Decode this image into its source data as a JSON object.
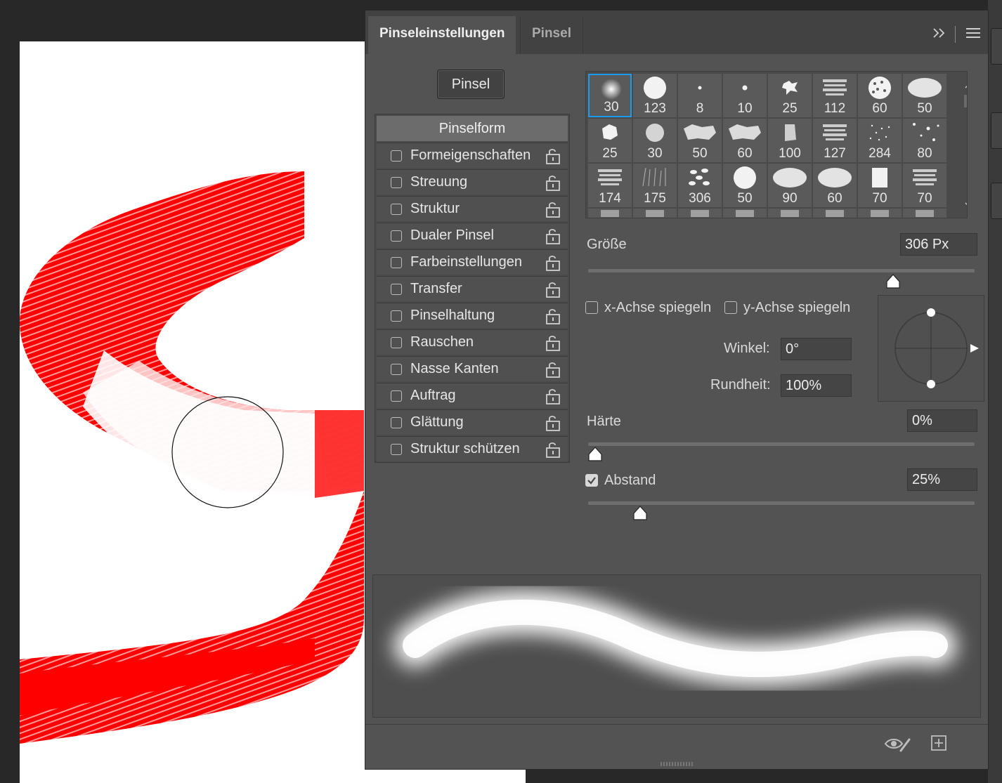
{
  "tabs": {
    "settings": "Pinseleinstellungen",
    "brush": "Pinsel"
  },
  "icons": {
    "collapse": "double-chevron-right-icon",
    "menu": "hamburger-menu-icon",
    "lock": "unlock-icon",
    "eye_brush": "toggle-preview-icon",
    "new_preset": "new-brush-preset-icon"
  },
  "brush_button": "Pinsel",
  "options": {
    "header": "Pinselform",
    "items": [
      {
        "label": "Formeigenschaften",
        "checked": false
      },
      {
        "label": "Streuung",
        "checked": false
      },
      {
        "label": "Struktur",
        "checked": false
      },
      {
        "label": "Dualer Pinsel",
        "checked": false
      },
      {
        "label": "Farbeinstellungen",
        "checked": false
      },
      {
        "label": "Transfer",
        "checked": false
      },
      {
        "label": "Pinselhaltung",
        "checked": false
      },
      {
        "label": "Rauschen",
        "checked": false
      },
      {
        "label": "Nasse Kanten",
        "checked": false
      },
      {
        "label": "Auftrag",
        "checked": false
      },
      {
        "label": "Glättung",
        "checked": false
      },
      {
        "label": "Struktur schützen",
        "checked": false
      }
    ]
  },
  "brush_tips": [
    {
      "size": "30",
      "kind": "soft-round",
      "selected": true
    },
    {
      "size": "123",
      "kind": "hard-round"
    },
    {
      "size": "8",
      "kind": "dot-small"
    },
    {
      "size": "10",
      "kind": "dot"
    },
    {
      "size": "25",
      "kind": "splat"
    },
    {
      "size": "112",
      "kind": "texture"
    },
    {
      "size": "60",
      "kind": "sponge"
    },
    {
      "size": "50",
      "kind": "oval-texture"
    },
    {
      "size": "25",
      "kind": "blob"
    },
    {
      "size": "30",
      "kind": "fuzzy"
    },
    {
      "size": "50",
      "kind": "chalk"
    },
    {
      "size": "60",
      "kind": "chalk"
    },
    {
      "size": "100",
      "kind": "stone"
    },
    {
      "size": "127",
      "kind": "texture"
    },
    {
      "size": "284",
      "kind": "spray"
    },
    {
      "size": "80",
      "kind": "spatter"
    },
    {
      "size": "174",
      "kind": "texture"
    },
    {
      "size": "175",
      "kind": "grass"
    },
    {
      "size": "306",
      "kind": "leaves"
    },
    {
      "size": "50",
      "kind": "hard-round"
    },
    {
      "size": "90",
      "kind": "oval-texture"
    },
    {
      "size": "60",
      "kind": "oval-texture"
    },
    {
      "size": "70",
      "kind": "square"
    },
    {
      "size": "70",
      "kind": "texture"
    }
  ],
  "size": {
    "label": "Größe",
    "value": "306 Px",
    "slider_fraction": 0.8
  },
  "flip": {
    "x_label": "x-Achse spiegeln",
    "y_label": "y-Achse spiegeln",
    "x_checked": false,
    "y_checked": false
  },
  "angle": {
    "label": "Winkel:",
    "value": "0°"
  },
  "roundness": {
    "label": "Rundheit:",
    "value": "100%"
  },
  "hardness": {
    "label": "Härte",
    "value": "0%",
    "slider_fraction": 0.0
  },
  "spacing": {
    "label": "Abstand",
    "value": "25%",
    "checked": true,
    "slider_fraction": 0.12
  },
  "colors": {
    "accent": "#1c9cf0",
    "stroke_red": "#ff0000"
  }
}
